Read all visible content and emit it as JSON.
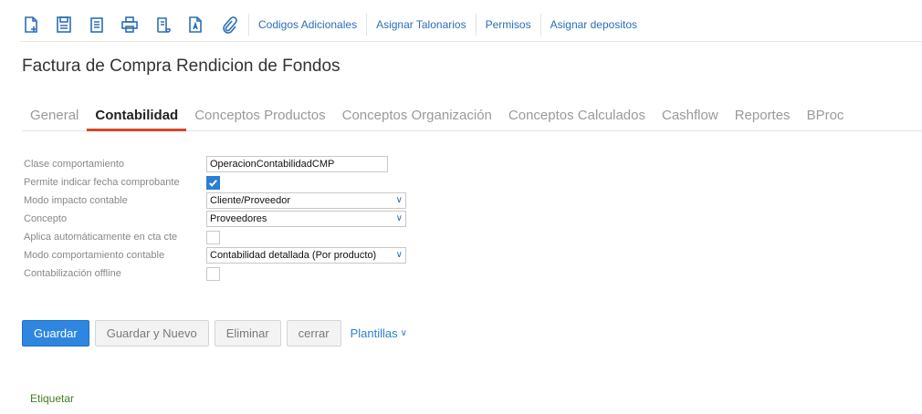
{
  "toolbar": {
    "icons": [
      "new-doc-icon",
      "save-icon",
      "document-list-icon",
      "print-icon",
      "scroll-icon",
      "text-doc-icon",
      "attachment-icon"
    ],
    "links": [
      "Codigos Adicionales",
      "Asignar Talonarios",
      "Permisos",
      "Asignar depositos"
    ]
  },
  "page": {
    "title": "Factura de Compra Rendicion de Fondos"
  },
  "tabs": [
    "General",
    "Contabilidad",
    "Conceptos Productos",
    "Conceptos Organización",
    "Conceptos Calculados",
    "Cashflow",
    "Reportes",
    "BProc"
  ],
  "active_tab": "Contabilidad",
  "form": {
    "clase_comportamiento": {
      "label": "Clase comportamiento",
      "value": "OperacionContabilidadCMP"
    },
    "permite_fecha": {
      "label": "Permite indicar fecha comprobante",
      "checked": true
    },
    "modo_impacto": {
      "label": "Modo impacto contable",
      "value": "Cliente/Proveedor"
    },
    "concepto": {
      "label": "Concepto",
      "value": "Proveedores"
    },
    "aplica_auto": {
      "label": "Aplica automáticamente en cta cte",
      "checked": false
    },
    "modo_comportamiento": {
      "label": "Modo comportamiento contable",
      "value": "Contabilidad detallada (Por producto)"
    },
    "offline": {
      "label": "Contabilización offline",
      "checked": false
    }
  },
  "actions": {
    "save": "Guardar",
    "save_new": "Guardar y Nuevo",
    "delete": "Eliminar",
    "close": "cerrar",
    "templates": "Plantillas"
  },
  "tag_link": "Etiquetar",
  "colors": {
    "accent": "#2a6fb6",
    "primary_button": "#2e86e0",
    "active_tab_underline": "#d9442a",
    "tag_link": "#3f7f1e"
  }
}
